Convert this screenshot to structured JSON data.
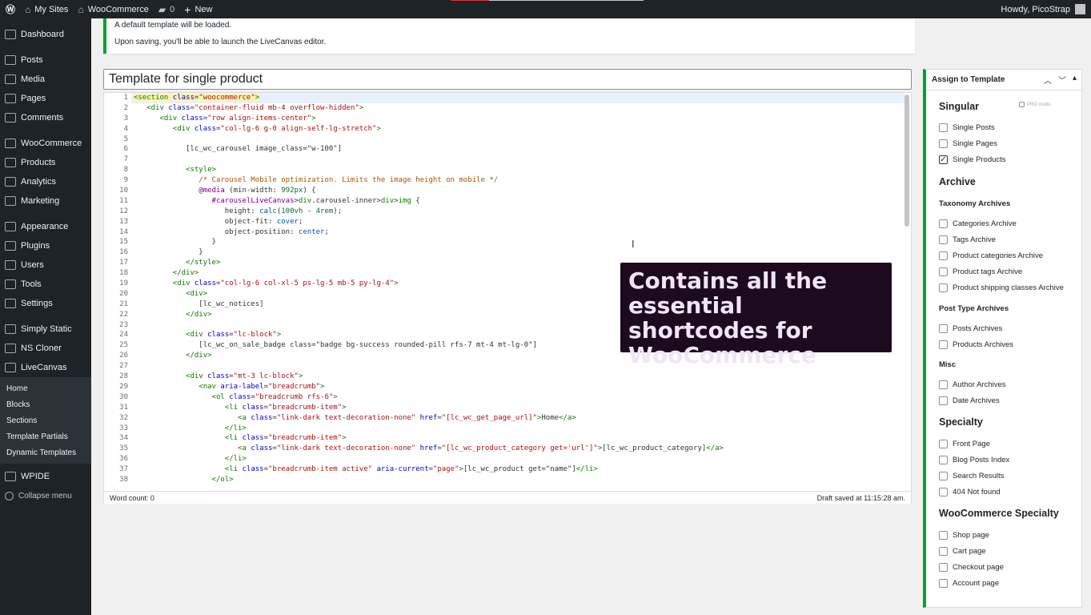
{
  "adminbar": {
    "my_sites": "My Sites",
    "site_name": "WooCommerce",
    "comments_count": "0",
    "new_label": "New",
    "greeting": "Howdy, PicoStrap"
  },
  "menu": {
    "dashboard": "Dashboard",
    "posts": "Posts",
    "media": "Media",
    "pages": "Pages",
    "comments": "Comments",
    "woocommerce": "WooCommerce",
    "products": "Products",
    "analytics": "Analytics",
    "marketing": "Marketing",
    "appearance": "Appearance",
    "plugins": "Plugins",
    "users": "Users",
    "tools": "Tools",
    "settings": "Settings",
    "simply_static": "Simply Static",
    "ns_cloner": "NS Cloner",
    "livecanvas": "LiveCanvas",
    "sub": {
      "home": "Home",
      "blocks": "Blocks",
      "sections": "Sections",
      "template_partials": "Template Partials",
      "dynamic_templates": "Dynamic Templates"
    },
    "wpide": "WPIDE",
    "collapse": "Collapse menu"
  },
  "notice": {
    "line1": "A default template will be loaded.",
    "line2": "Upon saving, you'll be able to launch the LiveCanvas editor."
  },
  "editor": {
    "title": "Template for single product",
    "word_count": "Word count: 0",
    "draft_saved": "Draft saved at 11:15:28 am.",
    "line_numbers": [
      "1",
      "2",
      "3",
      "4",
      "5",
      "6",
      "7",
      "8",
      "9",
      "10",
      "11",
      "12",
      "13",
      "14",
      "15",
      "16",
      "17",
      "18",
      "19",
      "20",
      "21",
      "22",
      "23",
      "24",
      "25",
      "26",
      "27",
      "28",
      "29",
      "30",
      "31",
      "32",
      "33",
      "34",
      "35",
      "36",
      "37",
      "38"
    ]
  },
  "overlay": {
    "text": "Contains all the essential shortcodes for WooCommerce"
  },
  "panel": {
    "title": "Assign to Template",
    "pro_mode": "PRO mode",
    "singular": "Singular",
    "single_posts": "Single Posts",
    "single_pages": "Single Pages",
    "single_products": "Single Products",
    "archive": "Archive",
    "taxonomy_archives": "Taxonomy Archives",
    "categories_archive": "Categories Archive",
    "tags_archive": "Tags Archive",
    "product_categories_archive": "Product categories Archive",
    "product_tags_archive": "Product tags Archive",
    "product_shipping_classes_archive": "Product shipping classes Archive",
    "post_type_archives": "Post Type Archives",
    "posts_archives": "Posts Archives",
    "products_archives": "Products Archives",
    "misc": "Misc",
    "author_archives": "Author Archives",
    "date_archives": "Date Archives",
    "specialty": "Specialty",
    "front_page": "Front Page",
    "blog_posts_index": "Blog Posts Index",
    "search_results": "Search Results",
    "not_found": "404 Not found",
    "woocommerce_specialty": "WooCommerce Specialty",
    "shop_page": "Shop page",
    "cart_page": "Cart page",
    "checkout_page": "Checkout page",
    "account_page": "Account page",
    "single_products_checked": true
  }
}
